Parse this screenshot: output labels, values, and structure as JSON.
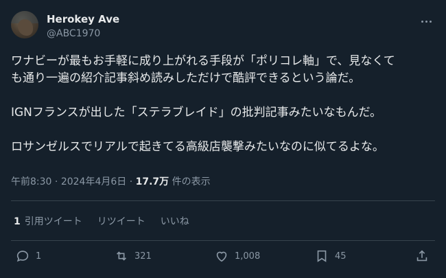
{
  "author": {
    "name": "Herokey Ave",
    "handle": "@ABC1970"
  },
  "tweet": {
    "lines": [
      "ワナビーが最もお手軽に成り上がれる手段が「ポリコレ軸」で、見なくて",
      "も通り一遍の紹介記事斜め読みしただけで酷評できるという論だ。",
      "IGNフランスが出した「ステラブレイド」の批判記事みたいなもんだ。",
      "ロサンゼルスでリアルで起きてる高級店襲撃みたいなのに似てるよな。"
    ]
  },
  "meta": {
    "time": "午前8:30",
    "sep": " · ",
    "date": "2024年4月6日",
    "sep2": " · ",
    "views": "17.7万",
    "views_label": " 件の表示"
  },
  "stats": {
    "quotes_count": "1",
    "quotes_label": "引用ツイート",
    "retweets_label": "リツイート",
    "likes_label": "いいね"
  },
  "actions": {
    "reply": "1",
    "retweet": "321",
    "like": "1,008",
    "bookmark": "45"
  },
  "colors": {
    "background": "#15202b",
    "text": "#e7e9ea",
    "muted": "#8b98a5",
    "divider": "#38444d"
  }
}
